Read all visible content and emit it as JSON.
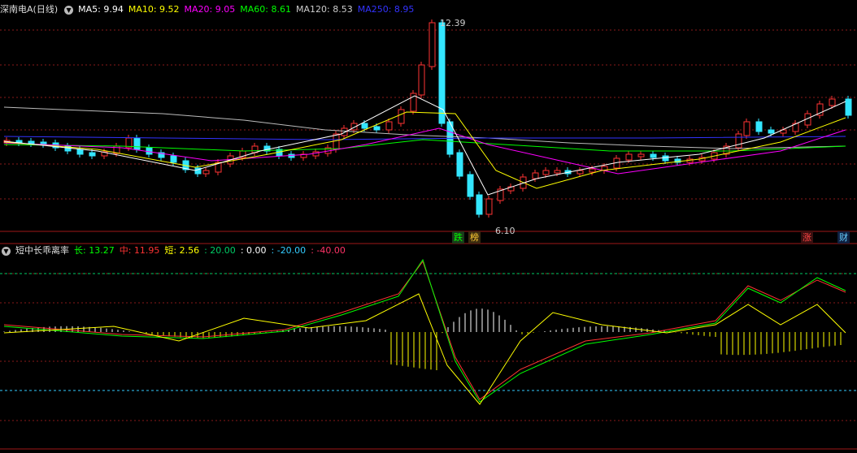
{
  "top_header": {
    "title": "深南电A(日线)",
    "ma": [
      {
        "label": "MA5: 9.94",
        "color": "#ffffff"
      },
      {
        "label": "MA10: 9.52",
        "color": "#ffff00"
      },
      {
        "label": "MA20: 9.05",
        "color": "#ff00ff"
      },
      {
        "label": "MA60: 8.61",
        "color": "#00ff00"
      },
      {
        "label": "MA120: 8.53",
        "color": "#cccccc"
      },
      {
        "label": "MA250: 8.95",
        "color": "#3333ff"
      }
    ]
  },
  "price_labels": {
    "high": "12.39",
    "low": "6.10"
  },
  "event_tags": [
    {
      "text": "跌",
      "color": "#00ff00",
      "bg": "#1a3a1a"
    },
    {
      "text": "榜",
      "color": "#ffcc33",
      "bg": "#3a2a10"
    },
    {
      "text": "涨",
      "color": "#ff4444",
      "bg": "#3a1010"
    },
    {
      "text": "财",
      "color": "#66ccff",
      "bg": "#102040"
    }
  ],
  "bottom_header": {
    "title": "短中长乖离率",
    "items": [
      {
        "label": "长: 13.27",
        "color": "#00ff00"
      },
      {
        "label": "中: 11.95",
        "color": "#ff3333"
      },
      {
        "label": "短: 2.56",
        "color": "#ffff00"
      },
      {
        "label": ": 20.00",
        "color": "#00cc66"
      },
      {
        "label": ": 0.00",
        "color": "#ffffff"
      },
      {
        "label": ": -20.00",
        "color": "#33ccff"
      },
      {
        "label": ": -40.00",
        "color": "#ff3366"
      }
    ]
  },
  "colors": {
    "up": "#ff3333",
    "down": "#33e6ff",
    "grid": "#8a1a1a"
  }
}
